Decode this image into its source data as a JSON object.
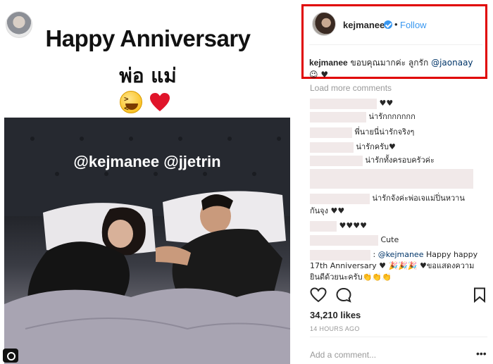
{
  "story": {
    "title": "Happy Anniversary",
    "subtitle": "พ่อ แม่",
    "photo_tags": "@kejmanee @jjetrin"
  },
  "post": {
    "username": "kejmanee",
    "separator": "•",
    "follow_label": "Follow",
    "caption_user": "kejmanee",
    "caption_text": "ขอบคุณมากค่ะ ลูกรัก",
    "caption_mention": "@jaonaay",
    "caption_emoji": "😉 ♥"
  },
  "comments": {
    "load_more": "Load more comments",
    "items": [
      {
        "text": "♥♥"
      },
      {
        "text": "น่ารักกกกกกก"
      },
      {
        "text": "พี่นายนี่น่ารักจริงๆ"
      },
      {
        "text": "น่ารักครับ♥"
      },
      {
        "text": "น่ารักทั้งครอบครัวค่ะ"
      },
      {
        "text": "น่ารักจังค่ะพ่อเจแม่ปิ่นหวาน"
      },
      {
        "text": "กันจุง ♥♥"
      },
      {
        "text": "♥♥♥♥"
      },
      {
        "text": "Cute"
      },
      {
        "text": ": "
      },
      {
        "mention": "@kejmanee",
        "text": " Happy happy"
      },
      {
        "text": "17th Anniversary ♥ 🎉🎉🎉 ♥ขอแสดงความ"
      },
      {
        "text": "ยินดีด้วยนะครับ👏👏👏"
      }
    ]
  },
  "engagement": {
    "likes": "34,210 likes",
    "time_ago": "14 HOURS AGO",
    "add_comment_placeholder": "Add a comment...",
    "options_glyph": "•••"
  },
  "colors": {
    "highlight_border": "#e00000",
    "link_blue": "#3897f0",
    "mention_blue": "#003569",
    "muted_gray": "#999999",
    "redaction_pink": "#f1e9e9"
  },
  "icons": [
    "heart-icon",
    "comment-icon",
    "bookmark-icon",
    "verified-icon",
    "camera-icon"
  ]
}
